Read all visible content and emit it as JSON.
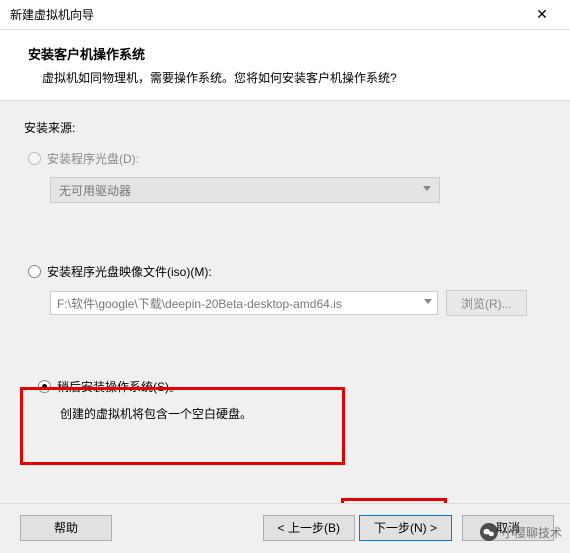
{
  "titlebar": {
    "text": "新建虚拟机向导"
  },
  "header": {
    "title": "安装客户机操作系统",
    "subtitle": "虚拟机如同物理机，需要操作系统。您将如何安装客户机操作系统?"
  },
  "source": {
    "label": "安装来源:",
    "opt_disc": {
      "label": "安装程序光盘(D):",
      "drive_text": "无可用驱动器"
    },
    "opt_iso": {
      "label": "安装程序光盘映像文件(iso)(M):",
      "path": "F:\\软件\\google\\下载\\deepin-20Beta-desktop-amd64.is",
      "browse": "浏览(R)..."
    },
    "opt_later": {
      "label": "稍后安装操作系统(S)。",
      "note": "创建的虚拟机将包含一个空白硬盘。"
    }
  },
  "footer": {
    "help": "帮助",
    "back": "< 上一步(B)",
    "next": "下一步(N) >",
    "cancel": "取消"
  },
  "watermark": {
    "text": "小樱聊技术"
  }
}
